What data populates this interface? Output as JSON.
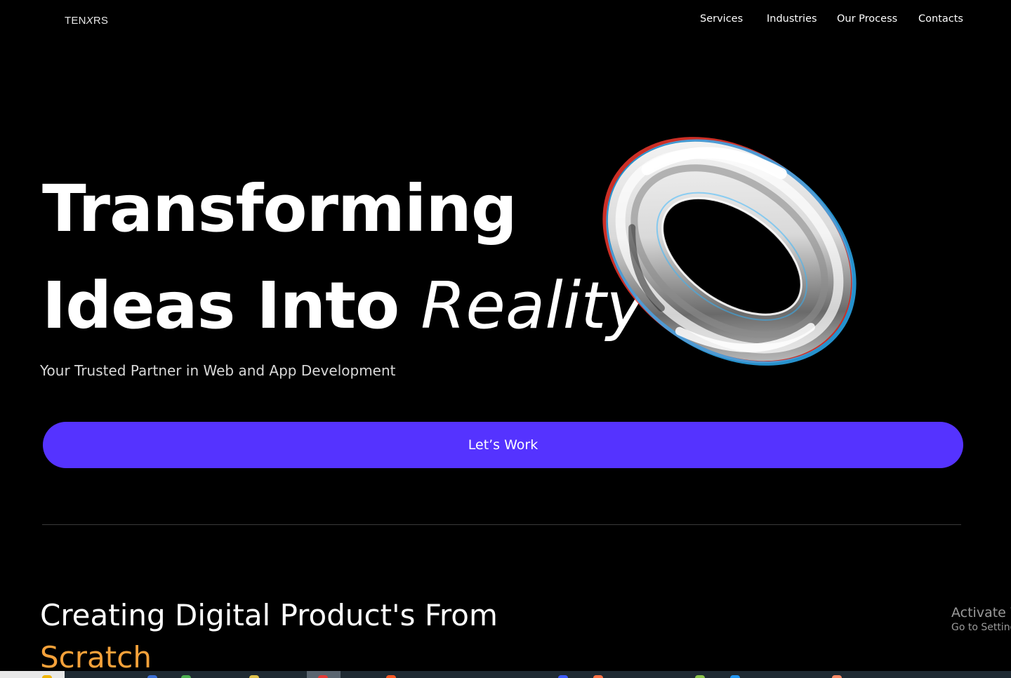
{
  "header": {
    "brand_prefix": "TEN",
    "brand_x": "X",
    "brand_suffix": "RS",
    "nav": [
      "Services",
      "Industries",
      "Our Process",
      "Contacts"
    ]
  },
  "hero": {
    "line1": "Transforming",
    "line2_plain": "Ideas Into ",
    "line2_italic": "Reality",
    "subtitle": "Your Trusted Partner in Web and App Development",
    "cta_label": "Let’s Work"
  },
  "section": {
    "title": "Creating Digital Product's From",
    "accent": "Scratch"
  },
  "overlay": {
    "activate_line1": "Activate Windows",
    "activate_line2": "Go to Settings to activate Windows."
  },
  "colors": {
    "background": "#000000",
    "cta": "#5533ff",
    "accent": "#f5a13a"
  }
}
